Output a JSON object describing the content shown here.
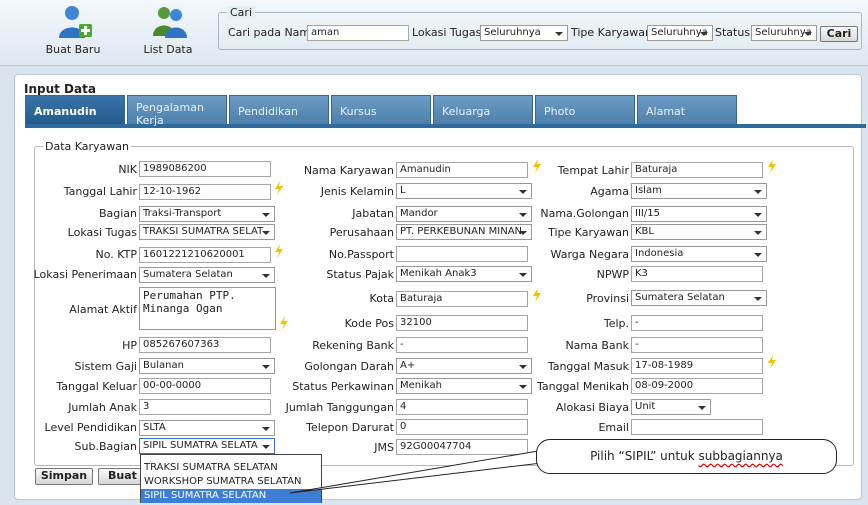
{
  "toolbar": {
    "new_label": "Buat Baru",
    "list_label": "List Data"
  },
  "search": {
    "legend": "Cari",
    "name_label": "Cari pada Nama:",
    "name_value": "aman",
    "location_label": "Lokasi Tugas:",
    "location_value": "Seluruhnya",
    "type_label": "Tipe Karyawan:",
    "type_value": "Seluruhnya",
    "status_label": "Status:",
    "status_value": "Seluruhnya",
    "button_label": "Cari"
  },
  "panel": {
    "title": "Input Data"
  },
  "tabs": [
    "Amanudin",
    "Pengalaman Kerja",
    "Pendidikan",
    "Kursus",
    "Keluarga",
    "Photo",
    "Alamat"
  ],
  "form": {
    "legend": "Data Karyawan",
    "col1": {
      "nik": {
        "label": "NIK",
        "value": "1989086200"
      },
      "tgl_lahir": {
        "label": "Tanggal Lahir",
        "value": "12-10-1962"
      },
      "bagian": {
        "label": "Bagian",
        "value": "Traksi-Transport"
      },
      "lokasi_tugas": {
        "label": "Lokasi Tugas",
        "value": "TRAKSI SUMATRA SELAT"
      },
      "no_ktp": {
        "label": "No. KTP",
        "value": "1601221210620001"
      },
      "lokasi_penerimaan": {
        "label": "Lokasi Penerimaan",
        "value": "Sumatera Selatan"
      },
      "alamat": {
        "label": "Alamat Aktif",
        "value": "Perumahan PTP.\nMinanga Ogan"
      },
      "hp": {
        "label": "HP",
        "value": "085267607363"
      },
      "sistem_gaji": {
        "label": "Sistem Gaji",
        "value": "Bulanan"
      },
      "tgl_keluar": {
        "label": "Tanggal Keluar",
        "value": "00-00-0000"
      },
      "jumlah_anak": {
        "label": "Jumlah Anak",
        "value": "3"
      },
      "level_pendidikan": {
        "label": "Level Pendidikan",
        "value": "SLTA"
      },
      "sub_bagian": {
        "label": "Sub.Bagian",
        "value": "SIPIL SUMATRA SELATA"
      }
    },
    "col2": {
      "nama": {
        "label": "Nama Karyawan",
        "value": "Amanudin"
      },
      "jenis_kelamin": {
        "label": "Jenis Kelamin",
        "value": "L"
      },
      "jabatan": {
        "label": "Jabatan",
        "value": "Mandor"
      },
      "perusahaan": {
        "label": "Perusahaan",
        "value": "PT. PERKEBUNAN MINAN"
      },
      "no_passport": {
        "label": "No.Passport",
        "value": ""
      },
      "status_pajak": {
        "label": "Status Pajak",
        "value": "Menikah Anak3"
      },
      "kota": {
        "label": "Kota",
        "value": "Baturaja"
      },
      "kode_pos": {
        "label": "Kode Pos",
        "value": "32100"
      },
      "rekening_bank": {
        "label": "Rekening Bank",
        "value": "-"
      },
      "golongan_darah": {
        "label": "Golongan Darah",
        "value": "A+"
      },
      "status_perkawinan": {
        "label": "Status Perkawinan",
        "value": "Menikah"
      },
      "jumlah_tanggungan": {
        "label": "Jumlah Tanggungan",
        "value": "4"
      },
      "telepon_darurat": {
        "label": "Telepon Darurat",
        "value": "0"
      },
      "jms": {
        "label": "JMS",
        "value": "92G00047704"
      }
    },
    "col3": {
      "tempat_lahir": {
        "label": "Tempat Lahir",
        "value": "Baturaja"
      },
      "agama": {
        "label": "Agama",
        "value": "Islam"
      },
      "nama_golongan": {
        "label": "Nama.Golongan",
        "value": "III/15"
      },
      "tipe_karyawan": {
        "label": "Tipe Karyawan",
        "value": "KBL"
      },
      "warga_negara": {
        "label": "Warga Negara",
        "value": "Indonesia"
      },
      "npwp": {
        "label": "NPWP",
        "value": "K3"
      },
      "provinsi": {
        "label": "Provinsi",
        "value": "Sumatera Selatan"
      },
      "telp": {
        "label": "Telp.",
        "value": "-"
      },
      "nama_bank": {
        "label": "Nama Bank",
        "value": "-"
      },
      "tgl_masuk": {
        "label": "Tanggal Masuk",
        "value": "17-08-1989"
      },
      "tgl_menikah": {
        "label": "Tanggal Menikah",
        "value": "08-09-2000"
      },
      "alokasi_biaya": {
        "label": "Alokasi Biaya",
        "value": "Unit"
      },
      "email": {
        "label": "Email",
        "value": ""
      }
    }
  },
  "buttons": {
    "save": "Simpan",
    "new": "Buat B"
  },
  "dropdown_options": [
    "TRAKSI SUMATRA SELATAN",
    "WORKSHOP SUMATRA SELATAN",
    "SIPIL SUMATRA SELATAN"
  ],
  "callout": {
    "prefix": "Pilih “SIPIL” untuk ",
    "underlined": "subbagiannya"
  }
}
